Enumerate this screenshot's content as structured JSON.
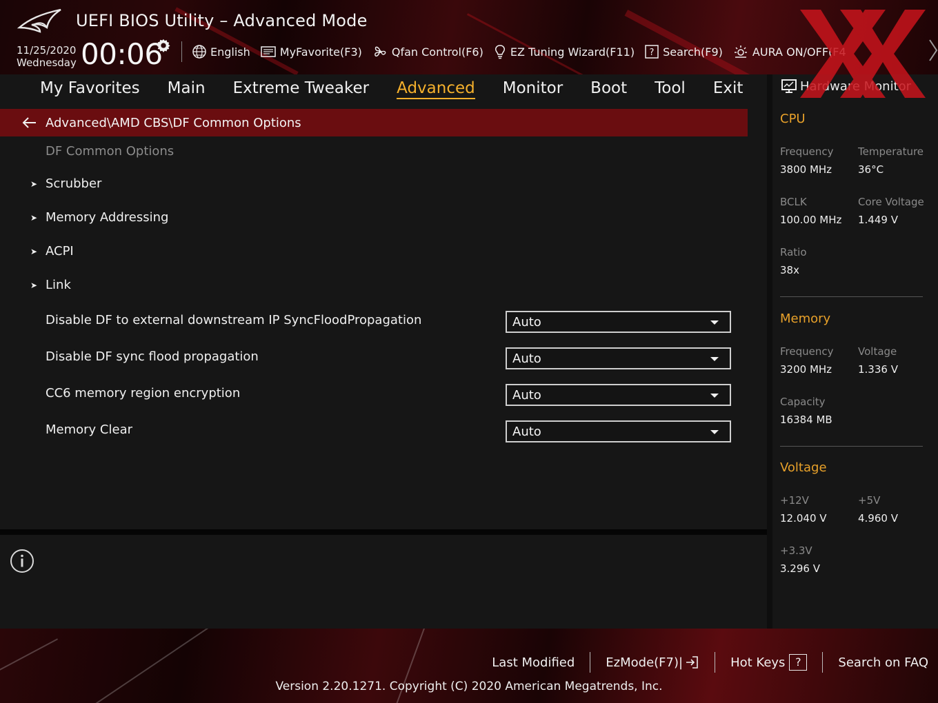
{
  "header": {
    "title": "UEFI BIOS Utility – Advanced Mode",
    "date": "11/25/2020",
    "weekday": "Wednesday",
    "time": "00:06",
    "toolbar": [
      {
        "label": "English",
        "icon": "globe-icon"
      },
      {
        "label": "MyFavorite(F3)",
        "icon": "favorite-list-icon"
      },
      {
        "label": "Qfan Control(F6)",
        "icon": "fan-icon"
      },
      {
        "label": "EZ Tuning Wizard(F11)",
        "icon": "lightbulb-icon"
      },
      {
        "label": "Search(F9)",
        "icon": "question-box-icon"
      },
      {
        "label": "AURA ON/OFF(F4",
        "icon": "aura-light-icon"
      }
    ]
  },
  "tabs": [
    {
      "label": "My Favorites",
      "active": false
    },
    {
      "label": "Main",
      "active": false
    },
    {
      "label": "Extreme Tweaker",
      "active": false
    },
    {
      "label": "Advanced",
      "active": true
    },
    {
      "label": "Monitor",
      "active": false
    },
    {
      "label": "Boot",
      "active": false
    },
    {
      "label": "Tool",
      "active": false
    },
    {
      "label": "Exit",
      "active": false
    }
  ],
  "main": {
    "breadcrumb": "Advanced\\AMD CBS\\DF Common Options",
    "section_heading": "DF Common Options",
    "submenus": [
      "Scrubber",
      "Memory Addressing",
      "ACPI",
      "Link"
    ],
    "options": [
      {
        "label": "Disable DF to external downstream IP SyncFloodPropagation",
        "value": "Auto"
      },
      {
        "label": "Disable DF sync flood propagation",
        "value": "Auto"
      },
      {
        "label": "CC6 memory region encryption",
        "value": "Auto"
      },
      {
        "label": "Memory Clear",
        "value": "Auto"
      }
    ]
  },
  "hardware_monitor": {
    "title": "Hardware Monitor",
    "cpu": {
      "heading": "CPU",
      "frequency_label": "Frequency",
      "frequency": "3800 MHz",
      "temperature_label": "Temperature",
      "temperature": "36°C",
      "bclk_label": "BCLK",
      "bclk": "100.00 MHz",
      "core_voltage_label": "Core Voltage",
      "core_voltage": "1.449 V",
      "ratio_label": "Ratio",
      "ratio": "38x"
    },
    "memory": {
      "heading": "Memory",
      "frequency_label": "Frequency",
      "frequency": "3200 MHz",
      "voltage_label": "Voltage",
      "voltage": "1.336 V",
      "capacity_label": "Capacity",
      "capacity": "16384 MB"
    },
    "voltage": {
      "heading": "Voltage",
      "v12_label": "+12V",
      "v12": "12.040 V",
      "v5_label": "+5V",
      "v5": "4.960 V",
      "v33_label": "+3.3V",
      "v33": "3.296 V"
    }
  },
  "footer": {
    "last_modified": "Last Modified",
    "ezmode": "EzMode(F7)|",
    "hot_keys": "Hot Keys",
    "hot_keys_key": "?",
    "search_faq": "Search on FAQ",
    "version": "Version 2.20.1271. Copyright (C) 2020 American Megatrends, Inc."
  },
  "colors": {
    "accent": "#f5b02c",
    "breadcrumb_bg": "#6a0d10",
    "panel_bg": "#161616",
    "section_heading": "#e8a12a"
  }
}
